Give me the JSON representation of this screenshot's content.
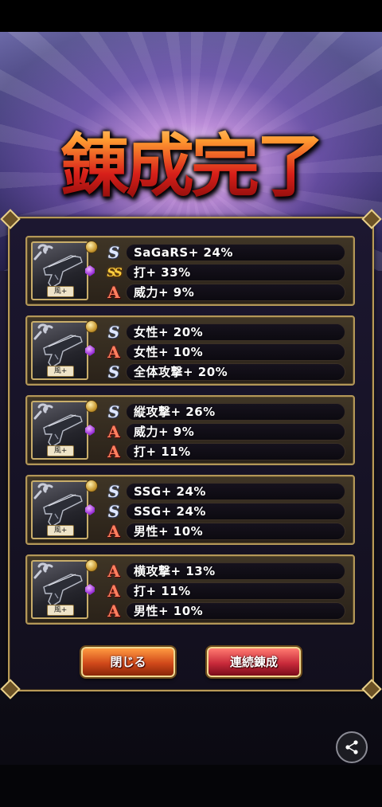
{
  "title": "錬成完了",
  "items": [
    {
      "attribute": "風+",
      "stats": [
        {
          "rank": "S",
          "text": "SaGaRS+ 24%"
        },
        {
          "rank": "SS",
          "text": "打+ 33%"
        },
        {
          "rank": "A",
          "text": "威力+ 9%"
        }
      ]
    },
    {
      "attribute": "風+",
      "stats": [
        {
          "rank": "S",
          "text": "女性+ 20%"
        },
        {
          "rank": "A",
          "text": "女性+ 10%"
        },
        {
          "rank": "S",
          "text": "全体攻撃+ 20%"
        }
      ]
    },
    {
      "attribute": "風+",
      "stats": [
        {
          "rank": "S",
          "text": "縦攻撃+ 26%"
        },
        {
          "rank": "A",
          "text": "威力+ 9%"
        },
        {
          "rank": "A",
          "text": "打+ 11%"
        }
      ]
    },
    {
      "attribute": "風+",
      "stats": [
        {
          "rank": "S",
          "text": "SSG+ 24%"
        },
        {
          "rank": "S",
          "text": "SSG+ 24%"
        },
        {
          "rank": "A",
          "text": "男性+ 10%"
        }
      ]
    },
    {
      "attribute": "風+",
      "stats": [
        {
          "rank": "A",
          "text": "横攻撃+ 13%"
        },
        {
          "rank": "A",
          "text": "打+ 11%"
        },
        {
          "rank": "A",
          "text": "男性+ 10%"
        }
      ]
    }
  ],
  "buttons": {
    "close": "閉じる",
    "repeat": "連続錬成"
  },
  "icons": {
    "share": "share-icon"
  },
  "colors": {
    "accent_gold": "#b89a58",
    "close_button": "#d0481a",
    "repeat_button": "#c82a3a"
  }
}
